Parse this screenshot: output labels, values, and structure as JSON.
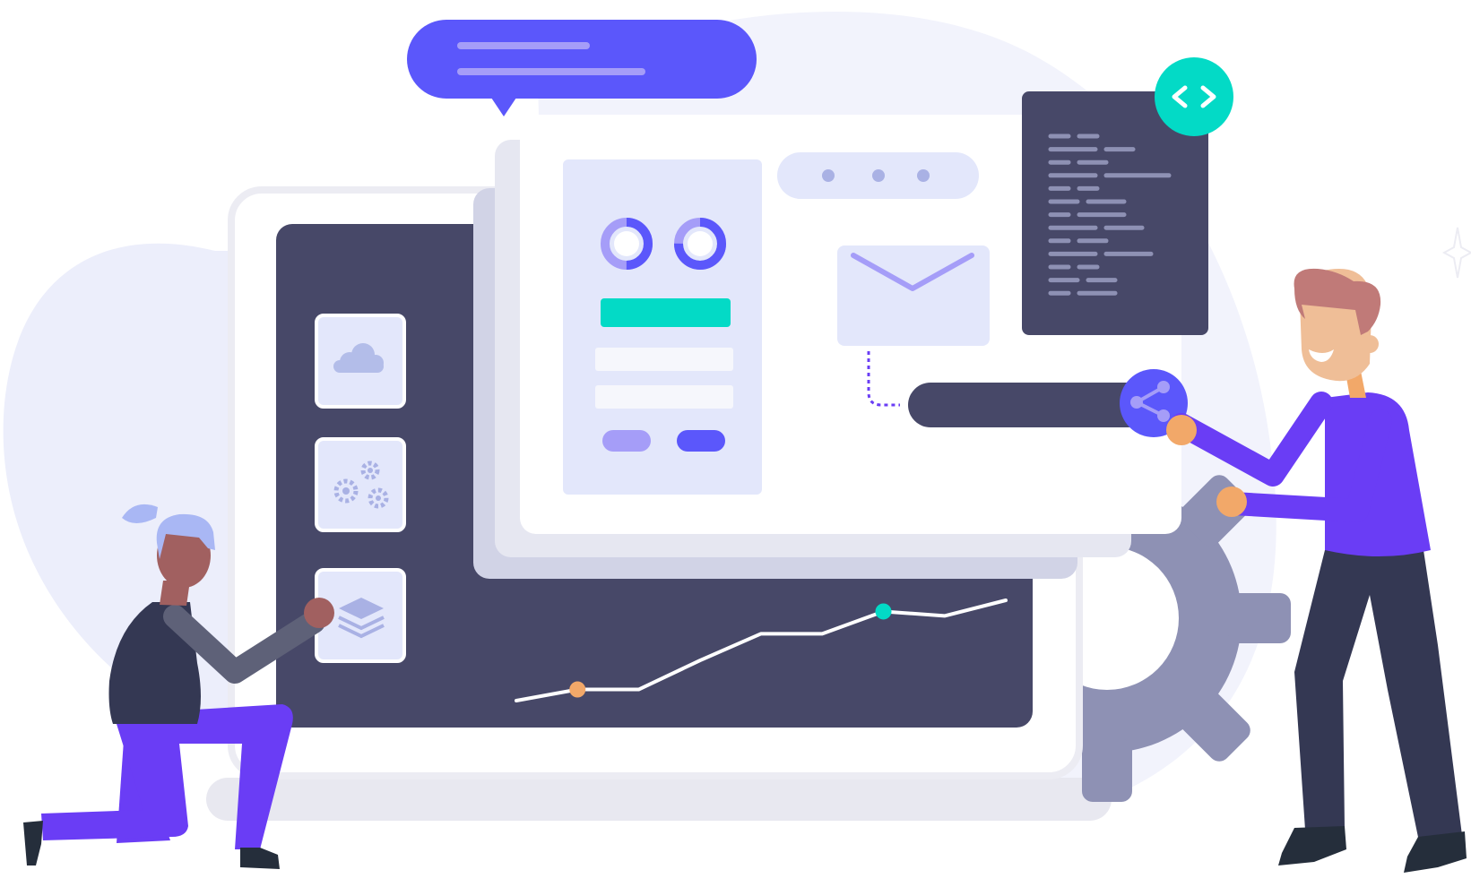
{
  "colors": {
    "background": "#ffffff",
    "blob_light": "#eef0fb",
    "navy": "#474868",
    "indigo": "#5b57fb",
    "violet": "#6a3df5",
    "lavender": "#a59df8",
    "pale_blue": "#e3e7fb",
    "teal": "#03dac6",
    "orange": "#f2a869",
    "gear_gray": "#8e91b4",
    "screen_frame": "#ececf3",
    "white": "#ffffff"
  },
  "icons": {
    "cloud": "cloud-icon",
    "gears": "gears-icon",
    "layers": "layers-icon",
    "mail": "mail-icon",
    "code": "code-brackets-icon",
    "share": "share-icon"
  },
  "chart_data": {
    "type": "line",
    "series": [
      {
        "values": [
          0,
          5,
          5,
          18,
          30,
          30,
          40,
          38,
          45
        ]
      }
    ],
    "highlighted_points": [
      1,
      6
    ]
  },
  "donuts": [
    {
      "fill": 0.5
    },
    {
      "fill": 0.75
    }
  ]
}
